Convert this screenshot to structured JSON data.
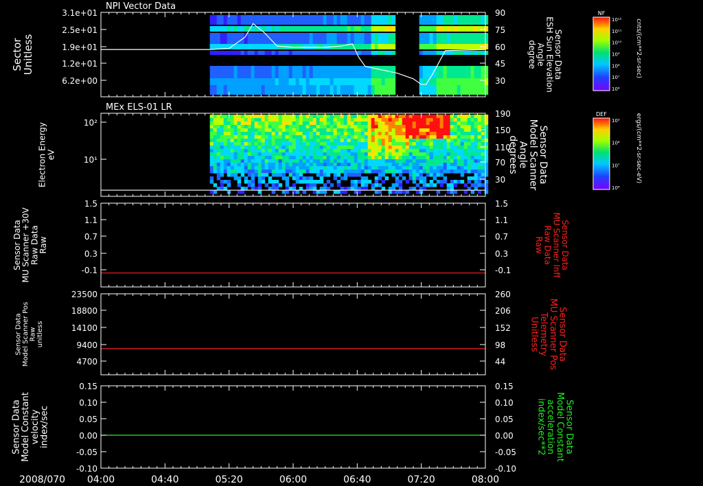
{
  "colors": {
    "background": "#000000",
    "foreground": "#ffffff",
    "red": "#ff2020",
    "green": "#22ee22"
  },
  "time_axis": {
    "date_label": "2008/070",
    "ticks": [
      "04:00",
      "04:40",
      "05:20",
      "06:00",
      "06:40",
      "07:20",
      "08:00"
    ],
    "range": [
      "04:00",
      "08:00"
    ]
  },
  "chart_data": [
    {
      "id": "npi",
      "type": "heatmap",
      "title": "NPI Vector Data",
      "ylabel": [
        "Sector",
        "Unitless"
      ],
      "yticks": [
        "3.1e+01",
        "2.5e+01",
        "1.9e+01",
        "1.2e+01",
        "6.2e+00"
      ],
      "ylim": [
        0,
        31
      ],
      "right_ylabel": [
        "Sensor Data",
        "ESH Sun Elevation",
        "Angle",
        "degree"
      ],
      "right_ylabel_color": "#ffffff",
      "right_yticks": [
        "90",
        "75",
        "60",
        "45",
        "30"
      ],
      "right_ylim": [
        15,
        90
      ],
      "colorbar": {
        "title": "NF",
        "unit": "cnts/(cm**2-sr-sec)",
        "ticks": [
          "10¹²",
          "10¹¹",
          "10¹⁰",
          "10⁹",
          "10⁸",
          "10⁷",
          "10⁶"
        ]
      },
      "data_start": "05:08",
      "gap": [
        "07:05",
        "07:18"
      ],
      "line_series": {
        "name": "ESH Sun Elevation Angle",
        "color": "#ffffff",
        "x": [
          "04:00",
          "05:08",
          "05:20",
          "05:30",
          "05:35",
          "05:42",
          "05:50",
          "06:00",
          "06:20",
          "06:30",
          "06:37",
          "06:41",
          "06:45",
          "06:55",
          "07:05",
          "07:15",
          "07:20",
          "07:23",
          "07:27",
          "07:35",
          "08:00"
        ],
        "y": [
          57,
          57,
          58,
          68,
          80,
          72,
          60,
          59,
          59,
          60,
          62,
          50,
          42,
          39,
          36,
          31,
          26,
          26,
          35,
          56,
          57
        ]
      }
    },
    {
      "id": "els",
      "type": "heatmap",
      "title": "MEx ELS-01 LR",
      "ylabel": [
        "Electron Energy",
        "eV"
      ],
      "yticks": [
        "10²",
        "10¹"
      ],
      "ylog": true,
      "ylim": [
        1,
        200
      ],
      "right_ylabel": [
        "Sensor Data",
        "Model Scanner",
        "Angle",
        "degrees"
      ],
      "right_ylabel_color": "#ffffff",
      "right_yticks": [
        "190",
        "150",
        "110",
        "70",
        "30"
      ],
      "right_ylim": [
        0,
        190
      ],
      "colorbar": {
        "title": "DEF",
        "unit": "ergs/(cm**2-sr-sec-eV)",
        "ticks": [
          "10⁹",
          "10⁸",
          "10⁷",
          "10⁶"
        ]
      },
      "data_start": "05:08",
      "line_series": {
        "name": "Model Scanner Angle",
        "color": "#ffffff",
        "x": [
          "04:00",
          "08:00"
        ],
        "y": [
          14,
          14
        ]
      }
    },
    {
      "id": "mu-raw",
      "type": "line",
      "ylabel": [
        "Sensor Data",
        "MU Scanner +30V",
        "Raw Data",
        "Raw"
      ],
      "yticks": [
        "1.5",
        "1.1",
        "0.7",
        "0.3",
        "-0.1"
      ],
      "ylim": [
        -0.3,
        1.5
      ],
      "right_ylabel": [
        "Sensor Data",
        "MU Scanner Inff",
        "Raw Data",
        "Raw"
      ],
      "right_ylabel_color": "#ff2020",
      "right_yticks": [
        "1.5",
        "1.1",
        "0.7",
        "0.3",
        "-0.1"
      ],
      "right_ylim": [
        -0.3,
        1.5
      ],
      "series": [
        {
          "name": "MU Scanner Inff Raw Data",
          "color": "#ff2020",
          "x": [
            "04:00",
            "08:00"
          ],
          "y": [
            0.0,
            0.0
          ]
        }
      ]
    },
    {
      "id": "mu-pos",
      "type": "line",
      "ylabel": [
        "Sensor Data",
        "Model Scanner Pos",
        "Raw",
        "unitless"
      ],
      "yticks": [
        "23500",
        "18800",
        "14100",
        "9400",
        "4700"
      ],
      "ylim": [
        0,
        23500
      ],
      "right_ylabel": [
        "Sensor Data",
        "MU Scanner Pos",
        "Telemetry",
        "Unitless"
      ],
      "right_ylabel_color": "#ff2020",
      "right_yticks": [
        "260",
        "206",
        "152",
        "98",
        "44"
      ],
      "right_ylim": [
        -10,
        260
      ],
      "series": [
        {
          "name": "MU Scanner Pos Telemetry",
          "color": "#ff2020",
          "x": [
            "04:00",
            "08:00"
          ],
          "y": [
            77,
            77
          ]
        }
      ]
    },
    {
      "id": "const",
      "type": "line",
      "ylabel": [
        "Sensor Data",
        "Model Constant",
        "velocity",
        "index/sec"
      ],
      "yticks": [
        "0.15",
        "0.10",
        "0.05",
        "0.00",
        "-0.05",
        "-0.10"
      ],
      "ylim": [
        -0.1,
        0.15
      ],
      "right_ylabel": [
        "Sensor Data",
        "Model Constant",
        "acceleration",
        "index/sec**2"
      ],
      "right_ylabel_color": "#22ee22",
      "right_yticks": [
        "0.15",
        "0.10",
        "0.05",
        "0.00",
        "-0.05",
        "-0.10"
      ],
      "right_ylim": [
        -0.1,
        0.15
      ],
      "series": [
        {
          "name": "Model Constant acceleration",
          "color": "#22ee22",
          "x": [
            "04:00",
            "08:00"
          ],
          "y": [
            0.0,
            0.0
          ]
        }
      ]
    }
  ]
}
